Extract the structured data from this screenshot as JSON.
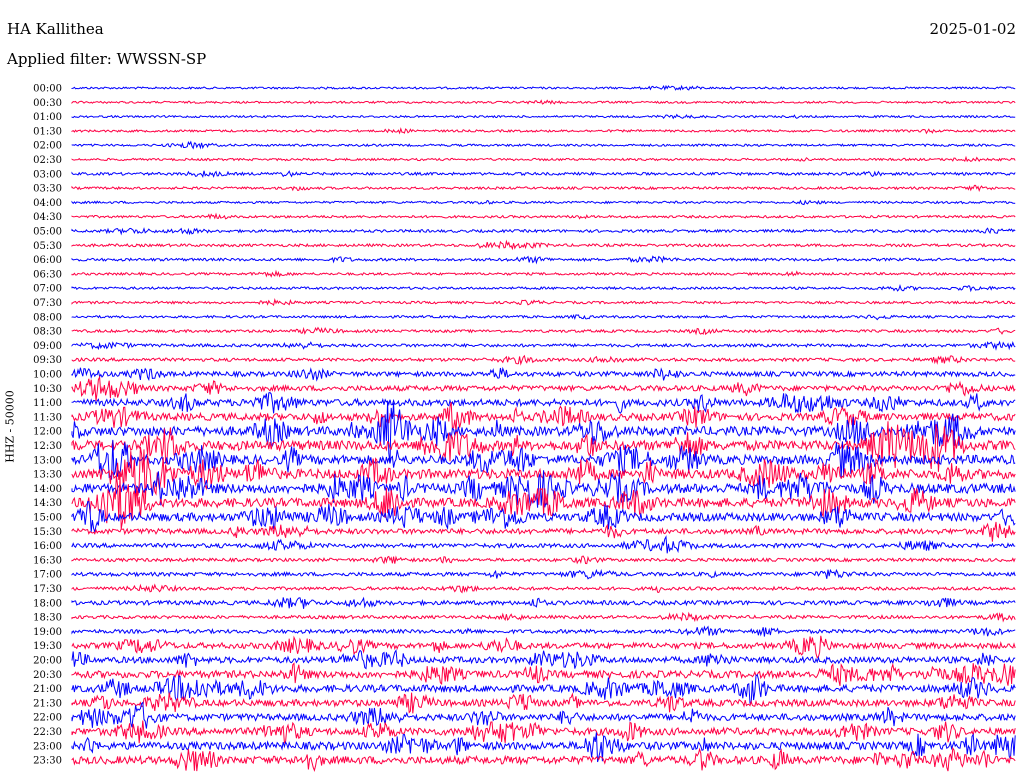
{
  "header": {
    "station": "HA Kallithea",
    "filter": "Applied filter: WWSSN-SP",
    "date": "2025-01-02"
  },
  "chart_data": {
    "type": "line",
    "ylabel": "HHZ - 50000",
    "colors": [
      "#0000ff",
      "#ff0044"
    ],
    "tick_labels": [
      "00:00",
      "00:30",
      "01:00",
      "01:30",
      "02:00",
      "02:30",
      "03:00",
      "03:30",
      "04:00",
      "04:30",
      "05:00",
      "05:30",
      "06:00",
      "06:30",
      "07:00",
      "07:30",
      "08:00",
      "08:30",
      "09:00",
      "09:30",
      "10:00",
      "10:30",
      "11:00",
      "11:30",
      "12:00",
      "12:30",
      "13:00",
      "13:30",
      "14:00",
      "14:30",
      "15:00",
      "15:30",
      "16:00",
      "16:30",
      "17:00",
      "17:30",
      "18:00",
      "18:30",
      "19:00",
      "19:30",
      "20:00",
      "20:30",
      "21:00",
      "21:30",
      "22:00",
      "22:30",
      "23:00",
      "23:30"
    ],
    "activity": [
      0.08,
      0.08,
      0.08,
      0.1,
      0.1,
      0.1,
      0.15,
      0.12,
      0.1,
      0.12,
      0.15,
      0.15,
      0.15,
      0.12,
      0.12,
      0.12,
      0.12,
      0.15,
      0.18,
      0.2,
      0.35,
      0.4,
      0.55,
      0.6,
      0.8,
      0.85,
      0.8,
      0.85,
      0.85,
      0.8,
      0.7,
      0.4,
      0.3,
      0.2,
      0.25,
      0.2,
      0.3,
      0.2,
      0.25,
      0.45,
      0.5,
      0.6,
      0.6,
      0.55,
      0.55,
      0.6,
      0.65,
      0.65
    ]
  }
}
